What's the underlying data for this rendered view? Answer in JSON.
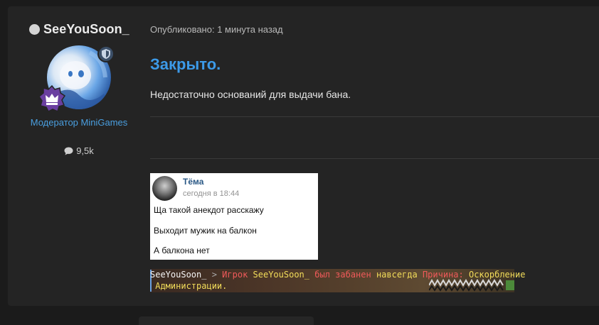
{
  "author": {
    "username": "SeeYouSoon_",
    "role": "Модератор MiniGames",
    "messages_count": "9,5k",
    "status_icon": "status-dot",
    "badge_icons": [
      "shield-icon",
      "crown-rank-icon"
    ]
  },
  "post": {
    "published": "Опубликовано: 1 минута назад",
    "heading": "Закрыто.",
    "body": "Недостаточно оснований для выдачи бана."
  },
  "vk_screenshot": {
    "name": "Тёма",
    "time": "сегодня в 18:44",
    "lines": [
      "Ща такой анекдот расскажу",
      "Выходит мужик на балкон",
      "А балкона нет"
    ]
  },
  "chat_log": {
    "sender": "SeeYouSoon_",
    "arrow": " > ",
    "part1": "Игрок ",
    "player": "SeeYouSoon_",
    "part2": " был забанен ",
    "duration": "навсегда",
    "part3": " Причина: ",
    "reason1": "Оскорбление",
    "reason2": " Администрации."
  },
  "colors": {
    "accent": "#3c9ae8",
    "role": "#4a9fe0",
    "vk_name": "#2a5885",
    "chat_red": "#f05a5a",
    "chat_yellow": "#f3dd5a"
  }
}
